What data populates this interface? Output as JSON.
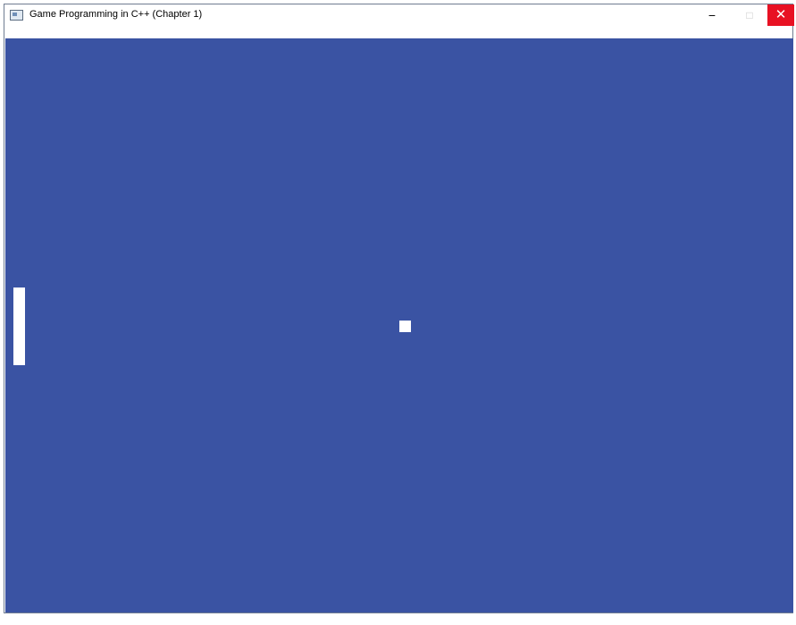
{
  "window": {
    "title": "Game Programming in C++ (Chapter 1)",
    "controls": {
      "minimize": "−",
      "maximize": "□",
      "close": "✕"
    }
  },
  "game": {
    "background_color": "#3a53a3",
    "paddle_color": "#ffffff",
    "ball_color": "#ffffff"
  },
  "icons": {
    "app": "app-window-icon"
  }
}
